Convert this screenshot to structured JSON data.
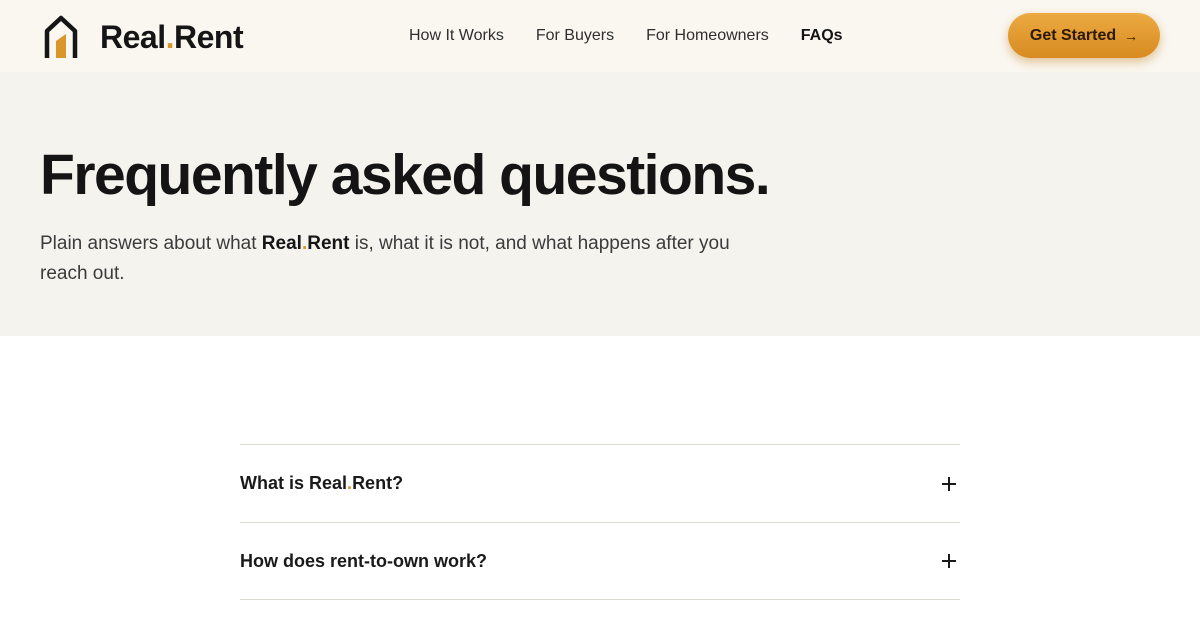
{
  "brand": {
    "name_part1": "Real",
    "name_dot": ".",
    "name_part2": "Rent",
    "logo_icon": "house-icon",
    "accent_color": "#d9962a",
    "dark_color": "#151515"
  },
  "nav": {
    "items": [
      {
        "label": "How It Works",
        "active": false
      },
      {
        "label": "For Buyers",
        "active": false
      },
      {
        "label": "For Homeowners",
        "active": false
      },
      {
        "label": "FAQs",
        "active": true
      }
    ]
  },
  "cta": {
    "label": "Get Started",
    "icon": "arrow-right-icon",
    "arrow": "→"
  },
  "hero": {
    "title": "Frequently asked questions.",
    "subtitle_before": "Plain answers about what ",
    "subtitle_after": " is, what it is not, and what happens after you reach out."
  },
  "faq": {
    "items": [
      {
        "question_before": "What is ",
        "question_after": "?",
        "has_brand": true
      },
      {
        "question": "How does rent-to-own work?",
        "has_brand": false
      }
    ],
    "expand_icon": "plus-icon"
  }
}
